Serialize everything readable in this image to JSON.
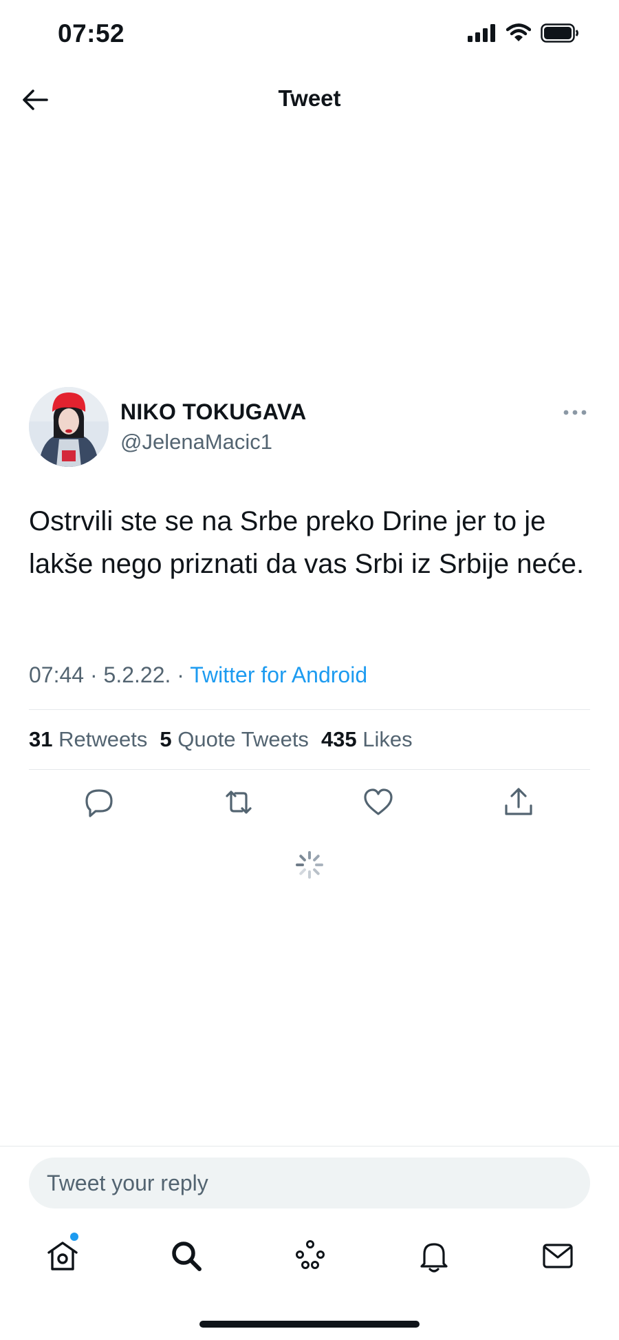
{
  "status_bar": {
    "time": "07:52"
  },
  "nav": {
    "title": "Tweet"
  },
  "tweet": {
    "author_name": "NIKO TOKUGAVA",
    "author_handle": "@JelenaMacic1",
    "text": "Ostrvili ste se na Srbe preko Drine jer to je lakše nego priznati da vas Srbi iz Srbije neće.",
    "time": "07:44",
    "separator1": " · ",
    "date": "5.2.22.",
    "separator2": " · ",
    "source": "Twitter for Android"
  },
  "stats": {
    "retweets_count": "31",
    "retweets_label": "Retweets",
    "quotes_count": "5",
    "quotes_label": "Quote Tweets",
    "likes_count": "435",
    "likes_label": "Likes"
  },
  "reply": {
    "placeholder": "Tweet your reply"
  },
  "icons": {
    "back": "arrow-left-icon",
    "more": "more-icon",
    "reply": "reply-icon",
    "retweet": "retweet-icon",
    "like": "heart-icon",
    "share": "share-icon",
    "spinner": "spinner-icon",
    "tabs": [
      "home-icon",
      "search-icon",
      "spaces-icon",
      "bell-icon",
      "mail-icon"
    ]
  },
  "colors": {
    "accent": "#1d9bf0",
    "text": "#0f1419",
    "muted": "#536471"
  }
}
